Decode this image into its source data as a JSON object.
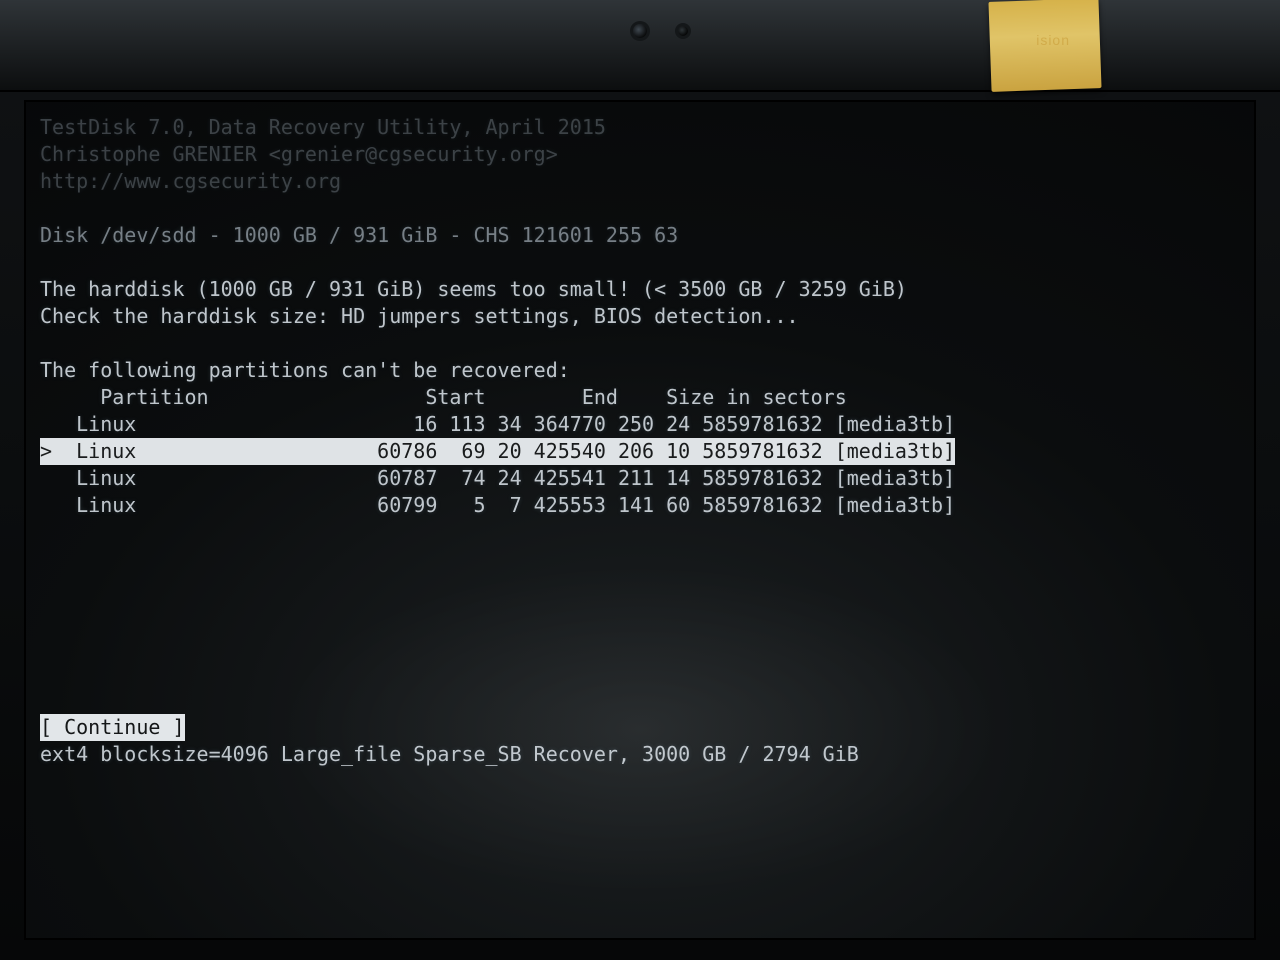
{
  "header": {
    "title": "TestDisk 7.0, Data Recovery Utility, April 2015",
    "author": "Christophe GRENIER <grenier@cgsecurity.org>",
    "url": "http://www.cgsecurity.org"
  },
  "disk_line": "Disk /dev/sdd - 1000 GB / 931 GiB - CHS 121601 255 63",
  "warning": {
    "line1": "The harddisk (1000 GB / 931 GiB) seems too small! (< 3500 GB / 3259 GiB)",
    "line2": "Check the harddisk size: HD jumpers settings, BIOS detection..."
  },
  "list_intro": "The following partitions can't be recovered:",
  "columns": "     Partition                  Start        End    Size in sectors",
  "partitions": [
    {
      "selected": false,
      "line": "   Linux                       16 113 34 364770 250 24 5859781632 [media3tb]"
    },
    {
      "selected": true,
      "line": ">  Linux                    60786  69 20 425540 206 10 5859781632 [media3tb]"
    },
    {
      "selected": false,
      "line": "   Linux                    60787  74 24 425541 211 14 5859781632 [media3tb]"
    },
    {
      "selected": false,
      "line": "   Linux                    60799   5  7 425553 141 60 5859781632 [media3tb]"
    }
  ],
  "menu": {
    "continue": "[ Continue ]"
  },
  "status_line": "ext4 blocksize=4096 Large_file Sparse_SB Recover, 3000 GB / 2794 GiB",
  "brand_fragment": "ision"
}
